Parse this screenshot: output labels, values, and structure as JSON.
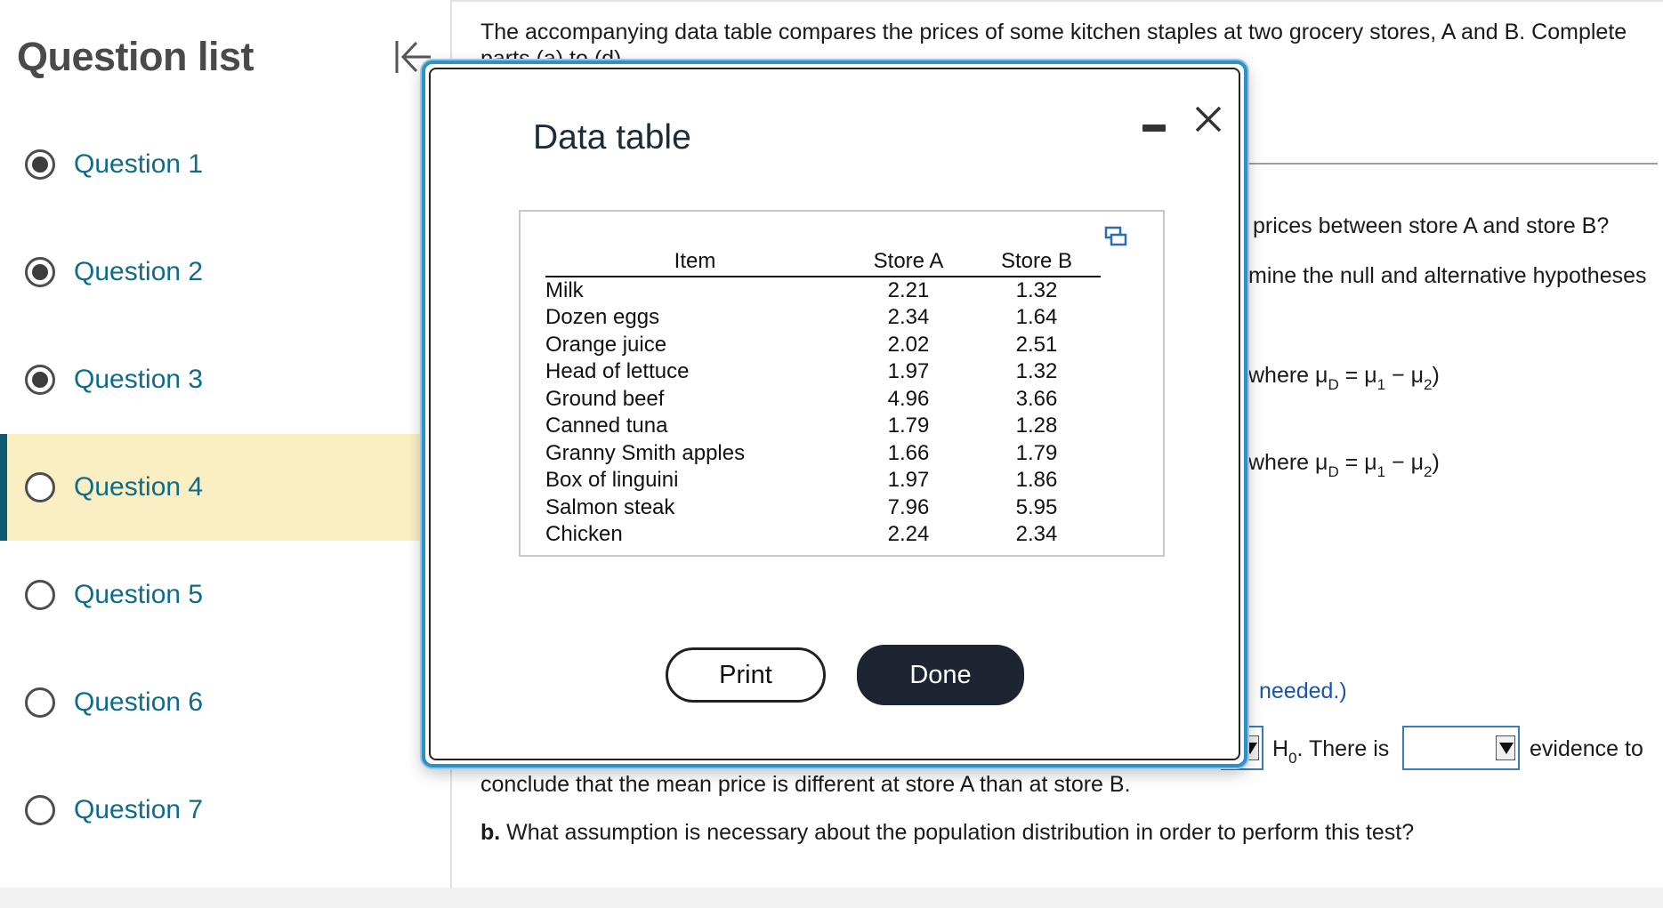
{
  "sidebar": {
    "title": "Question list",
    "items": [
      {
        "label": "Question 1",
        "state": "answered"
      },
      {
        "label": "Question 2",
        "state": "answered"
      },
      {
        "label": "Question 3",
        "state": "answered"
      },
      {
        "label": "Question 4",
        "state": "current"
      },
      {
        "label": "Question 5",
        "state": "unanswered"
      },
      {
        "label": "Question 6",
        "state": "unanswered"
      },
      {
        "label": "Question 7",
        "state": "unanswered"
      }
    ]
  },
  "main": {
    "intro_line1": "The accompanying data table compares the prices of some kitchen staples at two grocery stores, A and B. Complete",
    "intro_line2": "parts (a) to (d).",
    "partial_q_a": "prices between store A and store B?",
    "partial_hyp": "mine the null and alternative hypotheses",
    "where1_prefix": "where μ",
    "where1_sub": "D",
    "where1_rest": " = μ",
    "where1_sub1": "1",
    "where1_minus": " − μ",
    "where1_sub2": "2",
    "where1_close": ")",
    "needed": "needed.)",
    "h0_label": "H",
    "h0_sub": "0",
    "there_is": ". There is",
    "evidence_to": "evidence to",
    "conclude": "conclude that the mean price is different at store A than at store B.",
    "part_b_label": "b.",
    "part_b_text": " What assumption is necessary about the population distribution in order to perform this test?"
  },
  "modal": {
    "title": "Data table",
    "columns": [
      "Item",
      "Store A",
      "Store B"
    ],
    "rows": [
      [
        "Milk",
        "2.21",
        "1.32"
      ],
      [
        "Dozen eggs",
        "2.34",
        "1.64"
      ],
      [
        "Orange juice",
        "2.02",
        "2.51"
      ],
      [
        "Head of lettuce",
        "1.97",
        "1.32"
      ],
      [
        "Ground beef",
        "4.96",
        "3.66"
      ],
      [
        "Canned tuna",
        "1.79",
        "1.28"
      ],
      [
        "Granny Smith apples",
        "1.66",
        "1.79"
      ],
      [
        "Box of linguini",
        "1.97",
        "1.86"
      ],
      [
        "Salmon steak",
        "7.96",
        "5.95"
      ],
      [
        "Chicken",
        "2.24",
        "2.34"
      ]
    ],
    "print_label": "Print",
    "done_label": "Done"
  },
  "icons": {
    "collapse": "collapse-left-icon",
    "minimize": "minimize-icon",
    "close": "close-icon",
    "copy": "copy-table-icon"
  },
  "colors": {
    "link": "#0e6c8a",
    "active_bg": "#faeec3",
    "active_bar": "#0d5a73",
    "modal_border": "#2f90c6",
    "done_bg": "#1c2531"
  }
}
